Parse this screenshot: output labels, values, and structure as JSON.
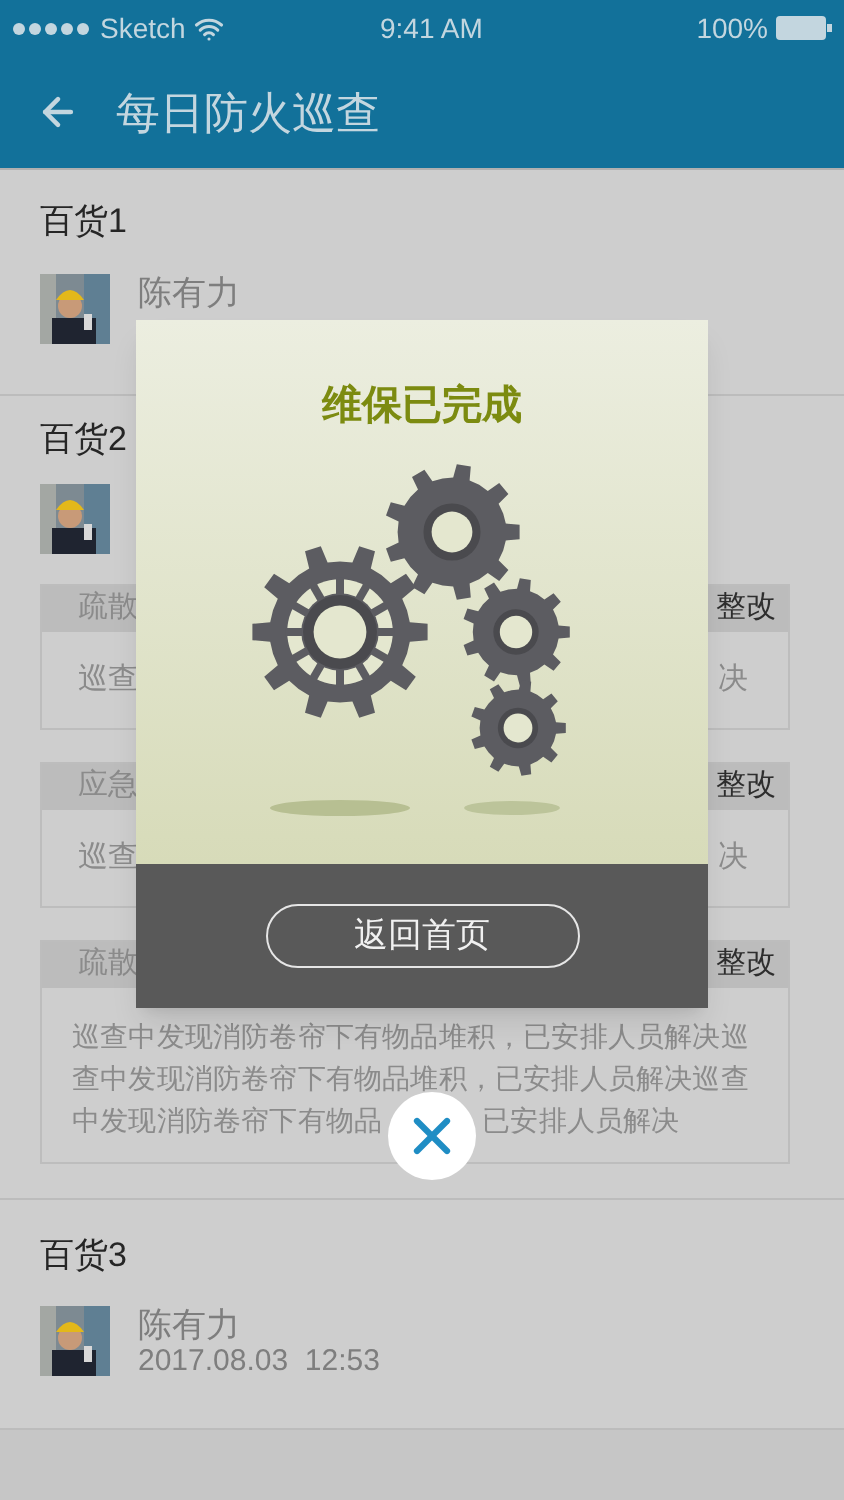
{
  "status_bar": {
    "carrier": "Sketch",
    "time": "9:41 AM",
    "battery": "100%"
  },
  "header": {
    "title": "每日防火巡查"
  },
  "stores": [
    {
      "name": "百货1",
      "inspector": "陈有力"
    },
    {
      "name": "百货2",
      "records": [
        {
          "kind": "short",
          "title_start": "疏散",
          "title_end": "整改",
          "body_start": "巡查",
          "body_end": "决"
        },
        {
          "kind": "short",
          "title_start": "应急",
          "title_end": "整改",
          "body_start": "巡查",
          "body_end": "决"
        },
        {
          "kind": "long",
          "title_start": "疏散",
          "title_end": "整改",
          "lines": [
            [
              "巡查中发现消防卷帘下有物品堆积，已安排人员解决巡"
            ],
            [
              "查中发现消防卷帘下有物品堆积，已安排人员解决巡查"
            ],
            [
              "中发现消防卷帘下有物品",
              "已安排人员解决"
            ]
          ]
        }
      ]
    },
    {
      "name": "百货3",
      "inspector": "陈有力",
      "time": "2017.08.03  12:53"
    }
  ],
  "dialog": {
    "title": "维保已完成",
    "button": "返回首页"
  }
}
